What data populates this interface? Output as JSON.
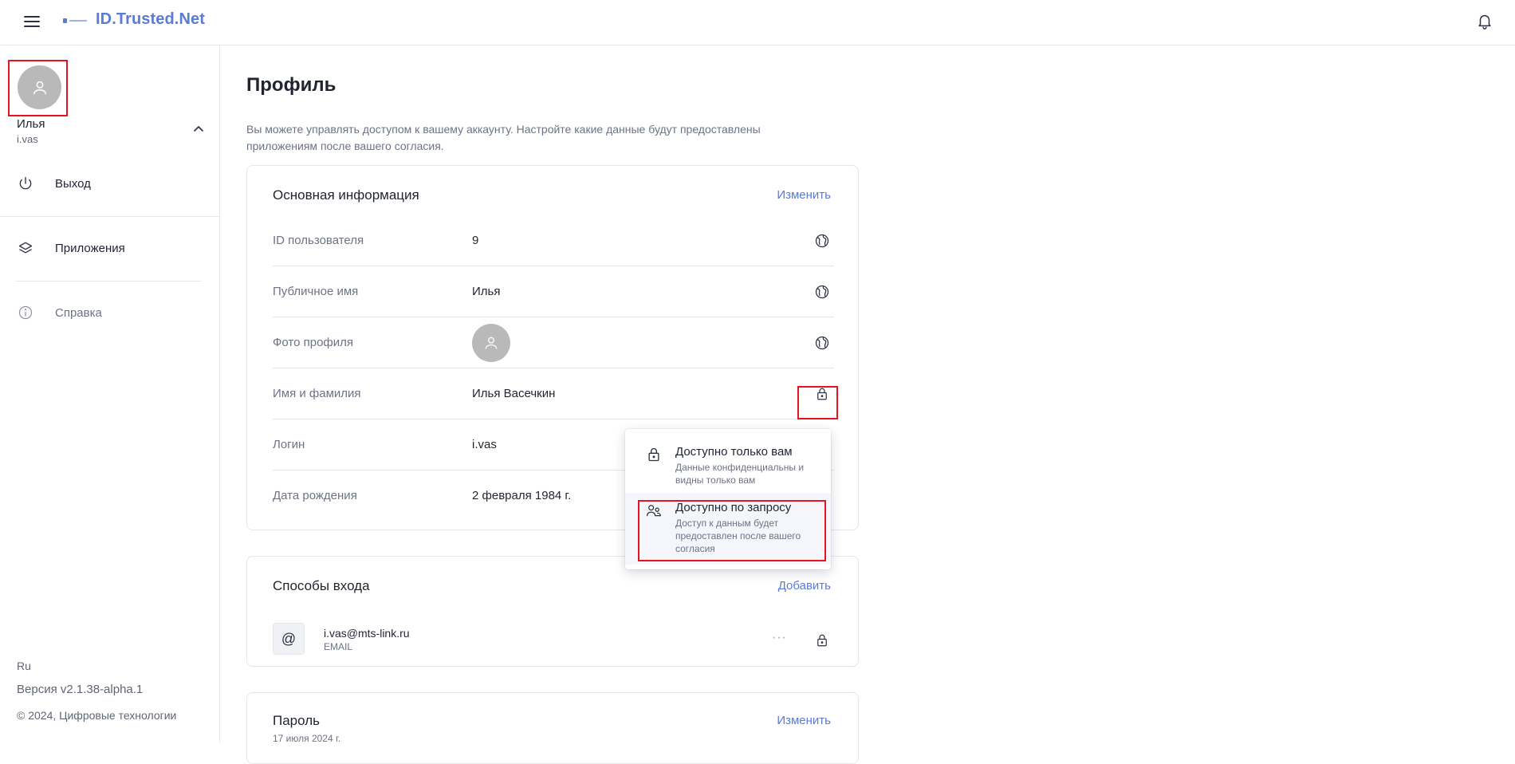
{
  "header": {
    "logo_text": "ID.Trusted.Net",
    "menu_icon": "hamburger-menu-icon",
    "notification_icon": "bell-icon"
  },
  "sidebar": {
    "user_name": "Илья",
    "user_login": "i.vas",
    "items": [
      {
        "label": "Выход",
        "icon": "power-icon"
      },
      {
        "label": "Приложения",
        "icon": "layers-icon"
      },
      {
        "label": "Справка",
        "icon": "info-icon"
      }
    ],
    "footer": {
      "language": "Ru",
      "version": "Версия v2.1.38-alpha.1",
      "copyright": "© 2024, Цифровые технологии"
    }
  },
  "main": {
    "title": "Профиль",
    "description": "Вы можете управлять доступом к вашему аккаунту. Настройте какие данные будут предоставлены приложениям после вашего согласия.",
    "basic_info": {
      "title": "Основная информация",
      "action": "Изменить",
      "rows": [
        {
          "label": "ID пользователя",
          "value": "9",
          "access_icon": "globe-icon"
        },
        {
          "label": "Публичное имя",
          "value": "Илья",
          "access_icon": "globe-icon"
        },
        {
          "label": "Фото профиля",
          "value": "",
          "access_icon": "globe-icon"
        },
        {
          "label": "Имя и фамилия",
          "value": "Илья Васечкин",
          "access_icon": "lock-icon"
        },
        {
          "label": "Логин",
          "value": "i.vas",
          "access_icon": ""
        },
        {
          "label": "Дата рождения",
          "value": "2 февраля 1984 г.",
          "access_icon": ""
        }
      ]
    },
    "access_menu": {
      "options": [
        {
          "title": "Доступно только вам",
          "subtitle": "Данные конфиденциальны и видны только вам",
          "icon": "lock-icon"
        },
        {
          "title": "Доступно по запросу",
          "subtitle": "Доступ к данным будет предоставлен после вашего согласия",
          "icon": "users-icon"
        }
      ]
    },
    "login_methods": {
      "title": "Способы входа",
      "action": "Добавить",
      "items": [
        {
          "value": "i.vas@mts-link.ru",
          "type": "EMAIL",
          "menu": "···"
        }
      ]
    },
    "password": {
      "title": "Пароль",
      "action": "Изменить",
      "date": "17 июля 2024 г."
    }
  }
}
